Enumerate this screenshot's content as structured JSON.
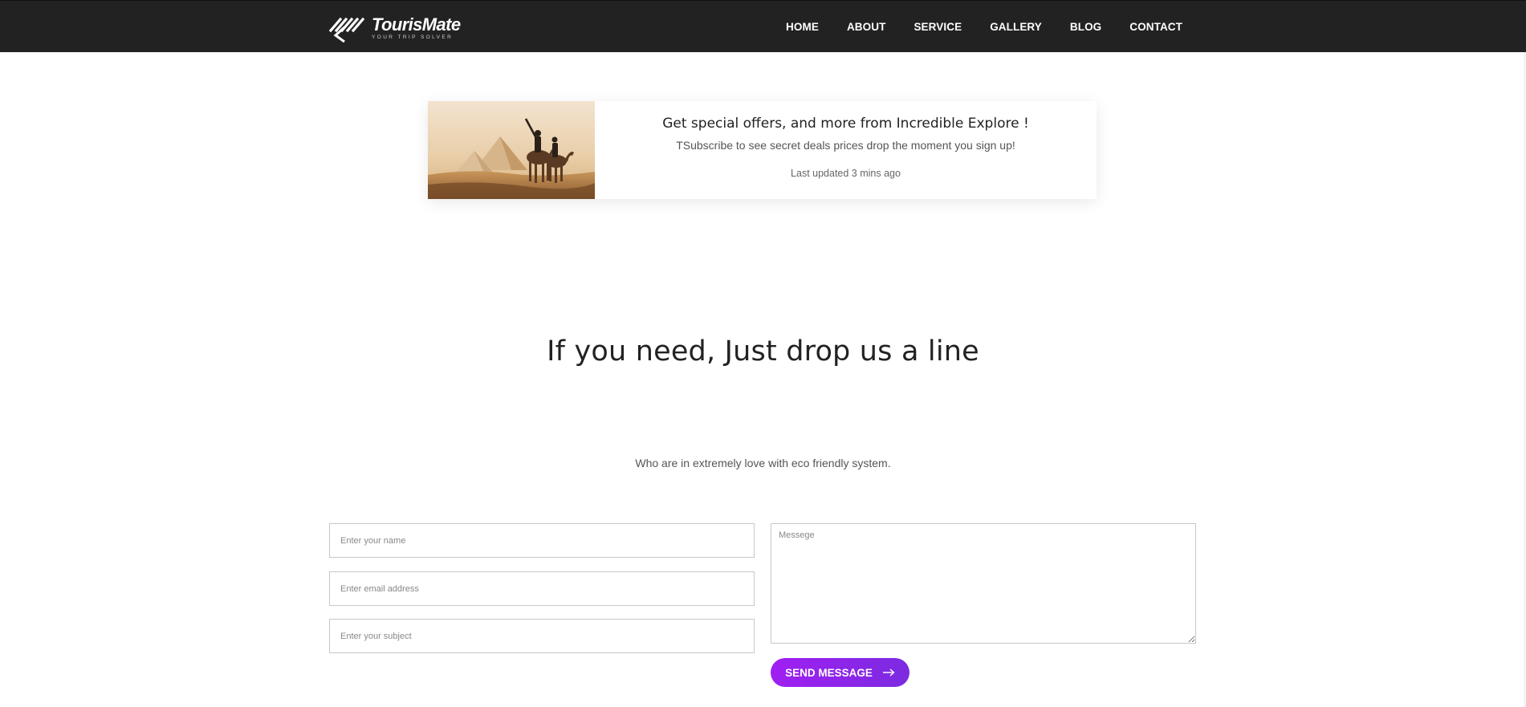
{
  "brand": {
    "name": "TourisMate",
    "tagline": "YOUR TRIP SOLVER",
    "logo_icon": "stripes-arrow-icon"
  },
  "nav": {
    "items": [
      {
        "label": "HOME"
      },
      {
        "label": "ABOUT"
      },
      {
        "label": "SERVICE"
      },
      {
        "label": "GALLERY"
      },
      {
        "label": "BLOG"
      },
      {
        "label": "CONTACT"
      }
    ]
  },
  "offer": {
    "image": "pyramids-camel-riders-photo",
    "title": "Get special offers, and more from Incredible Explore !",
    "subtitle": "TSubscribe to see secret deals prices drop the moment you sign up!",
    "updated": "Last updated 3 mins ago"
  },
  "contact": {
    "title": "If you need, Just drop us a line",
    "subtitle": "Who are in extremely love with eco friendly system.",
    "name_placeholder": "Enter your name",
    "email_placeholder": "Enter email address",
    "subject_placeholder": "Enter your subject",
    "message_placeholder": "Messege",
    "send_label": "SEND MESSAGE",
    "send_icon": "arrow-right-icon"
  },
  "colors": {
    "header_bg": "#222222",
    "accent_start": "#a01ff2",
    "accent_end": "#7b2be0",
    "text_dark": "#222222",
    "text_muted": "#555555"
  }
}
